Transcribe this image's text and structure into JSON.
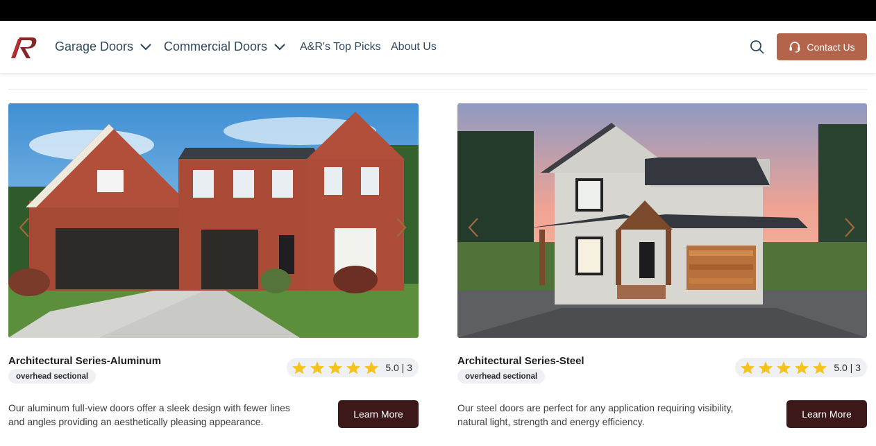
{
  "nav": {
    "logo_name": "A&R logo",
    "items": [
      {
        "label": "Garage Doors",
        "has_dropdown": true
      },
      {
        "label": "Commercial Doors",
        "has_dropdown": true
      },
      {
        "label": "A&R's Top Picks",
        "has_dropdown": false
      },
      {
        "label": "About Us",
        "has_dropdown": false
      }
    ],
    "search_icon": "search-icon",
    "contact_label": "Contact Us",
    "contact_icon": "headset-icon"
  },
  "colors": {
    "top_bar": "#000000",
    "nav_text": "#2f4a5c",
    "contact_button": "#b4644a",
    "learn_button": "#3d1818",
    "star": "#f6c21c",
    "tag_bg": "#eef0f4"
  },
  "products": [
    {
      "title": "Architectural Series-Aluminum",
      "tag": "overhead sectional",
      "stars": 5,
      "rating_text": "5.0 | 3",
      "description": "Our aluminum full-view doors offer a sleek design with fewer lines and angles providing an aesthetically pleasing appearance.",
      "button": "Learn More",
      "image": "brick two-story house with three black garage doors"
    },
    {
      "title": "Architectural Series-Steel",
      "tag": "overhead sectional",
      "stars": 5,
      "rating_text": "5.0 | 3",
      "description": "Our steel doors are perfect for any application requiring visibility, natural light, strength and energy efficiency.",
      "button": "Learn More",
      "image": "white farmhouse with wood-grain garage door at sunset"
    }
  ]
}
